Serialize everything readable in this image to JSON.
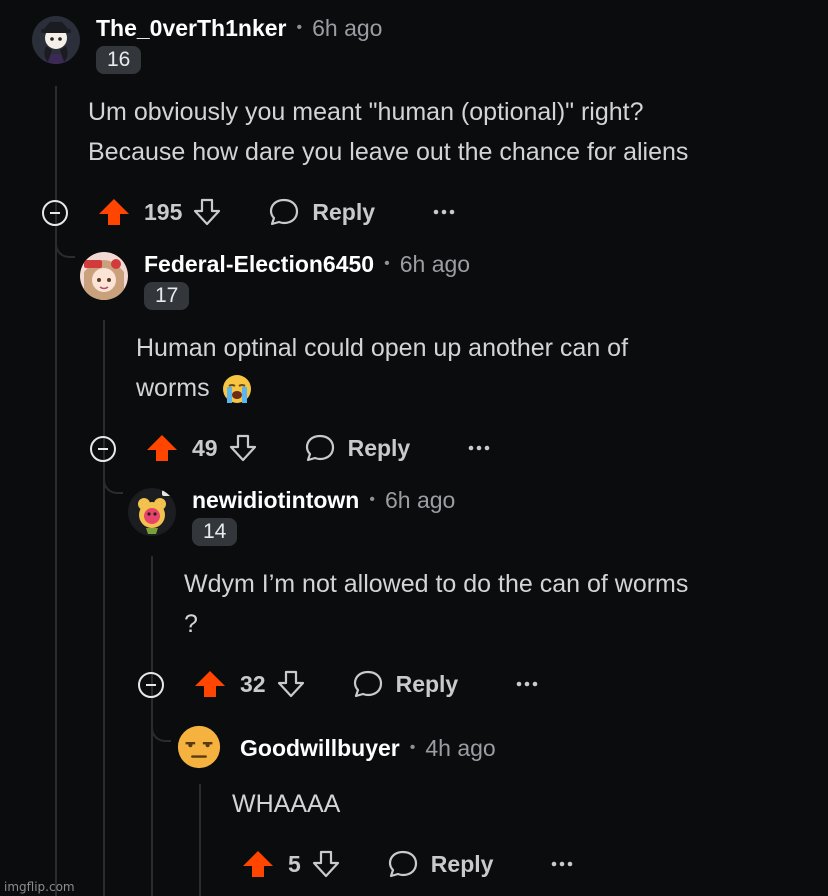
{
  "comments": [
    {
      "username": "The_0verTh1nker",
      "separator": "•",
      "time": "6h ago",
      "flair": "16",
      "body_lines": [
        "Um obviously you meant \"human (optional)\" right?",
        "Because how dare you leave out the chance for aliens"
      ],
      "votes": "195",
      "reply_label": "Reply",
      "avatar_icon": "ninja-avatar-icon"
    },
    {
      "username": "Federal-Election6450",
      "separator": "•",
      "time": "6h ago",
      "flair": "17",
      "body_lines": [
        "Human optinal could open up another can of",
        "worms"
      ],
      "emoji": "loudly-crying-face-emoji",
      "votes": "49",
      "reply_label": "Reply",
      "avatar_icon": "girl-avatar-icon"
    },
    {
      "username": "newidiotintown",
      "separator": "•",
      "time": "6h ago",
      "flair": "14",
      "body_lines": [
        "Wdym I’m not allowed to do the can of worms",
        "?"
      ],
      "votes": "32",
      "reply_label": "Reply",
      "avatar_icon": "flower-creature-avatar-icon"
    },
    {
      "username": "Goodwillbuyer",
      "separator": "•",
      "time": "4h ago",
      "body_lines": [
        "WHAAAA"
      ],
      "votes": "5",
      "reply_label": "Reply",
      "avatar_icon": "unamused-face-avatar-icon"
    }
  ],
  "watermark": "imgflip.com",
  "colors": {
    "background": "#0b0c0e",
    "upvote": "#ff4500",
    "flair_bg": "#33373b",
    "thread_line": "#2a2d30"
  }
}
